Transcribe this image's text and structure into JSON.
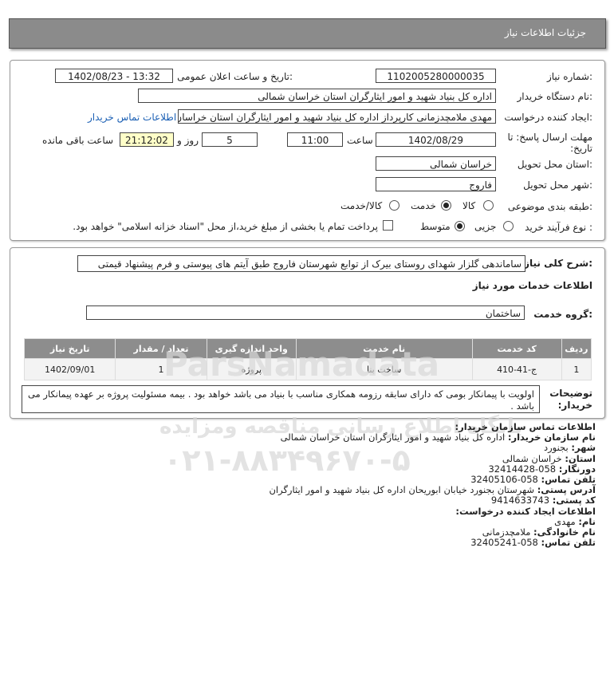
{
  "header": {
    "title": "جزئیات اطلاعات نیاز"
  },
  "form": {
    "need_number_label": "شماره نیاز:",
    "need_number": "1102005280000035",
    "announce_label": "تاریخ و ساعت اعلان عمومی:",
    "announce_value": "1402/08/23 - 13:32",
    "buyer_label": "نام دستگاه خریدار:",
    "buyer_value": "اداره کل بنیاد شهید و امور ایثارگران استان خراسان شمالی",
    "creator_label": "ایجاد کننده درخواست:",
    "creator_value": "مهدی  ملامچدزمانی کارپرداز اداره کل بنیاد شهید و امور ایثارگران استان خراسان",
    "contact_link": "اطلاعات تماس خریدار",
    "deadline_label": "مهلت ارسال پاسخ: تا تاریخ:",
    "deadline_date": "1402/08/29",
    "time_label": "ساعت",
    "deadline_time": "11:00",
    "days_value": "5",
    "days_label": "روز و",
    "remaining_time": "21:12:02",
    "remaining_label": "ساعت باقی مانده",
    "province_label": "استان محل تحویل:",
    "province_value": "خراسان شمالی",
    "city_label": "شهر محل تحویل:",
    "city_value": "فاروج",
    "category_label": "طبقه بندی موضوعی:",
    "category_options": [
      "کالا",
      "خدمت",
      "کالا/خدمت"
    ],
    "category_selected": "خدمت",
    "process_label": "نوع فرآیند خرید :",
    "process_options": [
      "جزیی",
      "متوسط"
    ],
    "process_selected": "متوسط",
    "payment_text": "پرداخت تمام یا بخشی از مبلغ خرید،از محل \"اسناد خزانه اسلامی\" خواهد بود."
  },
  "description": {
    "label": "شرح کلی نیاز:",
    "value": "ساماندهی گلزار شهدای روستای بیرک از توابع شهرستان فاروج طبق آیتم های پیوستی و فرم پیشنهاد قیمتی",
    "services_title": "اطلاعات خدمات مورد نیاز",
    "group_label": "گروه خدمت:",
    "group_value": "ساختمان"
  },
  "table": {
    "headers": [
      "ردیف",
      "کد خدمت",
      "نام خدمت",
      "واحد اندازه گیری",
      "تعداد / مقدار",
      "تاریخ نیاز"
    ],
    "rows": [
      [
        "1",
        "ج-41-410",
        "ساخت بنا",
        "پروژه",
        "1",
        "1402/09/01"
      ]
    ]
  },
  "notes": {
    "label": "توضیحات خریدار:",
    "value": "اولویت با پیمانکار بومی که دارای سابقه رزومه همکاری مناسب با بنیاد می باشد خواهد بود . بیمه مسئولیت پروژه بر عهده پیمانکار می باشد ."
  },
  "buyer_contact": {
    "title": "اطلاعات تماس سازمان خریدار:",
    "org_label": "نام سازمان خریدار:",
    "org_value": "اداره کل بنیاد شهید و امور ایثارگران استان خراسان شمالی",
    "city_label": "شهر:",
    "city_value": "بجنورد",
    "province_label": "استان:",
    "province_value": "خراسان شمالی",
    "fax_label": "دورنگار:",
    "fax_value": "058-32414428",
    "phone_label": "تلفن تماس:",
    "phone_value": "058-32405106",
    "address_label": "آدرس پستی:",
    "address_value": "شهرستان بجنورد خیابان ابوریحان اداره کل بنیاد شهید و امور ایثارگران",
    "postal_label": "کد پستی:",
    "postal_value": "9414633743"
  },
  "creator_contact": {
    "title": "اطلاعات ایجاد کننده درخواست:",
    "name_label": "نام:",
    "name_value": "مهدی",
    "family_label": "نام خانوادگی:",
    "family_value": "ملامچدزمانی",
    "phone_label": "تلفن تماس:",
    "phone_value": "058-32405241"
  },
  "watermark": {
    "brand": "ParsNamadata",
    "line1": "پایگاه اطلاع رسانی مناقصه ومزایده",
    "phone": "۰۲۱-۸۸۳۴۹۶۷۰-۵"
  }
}
